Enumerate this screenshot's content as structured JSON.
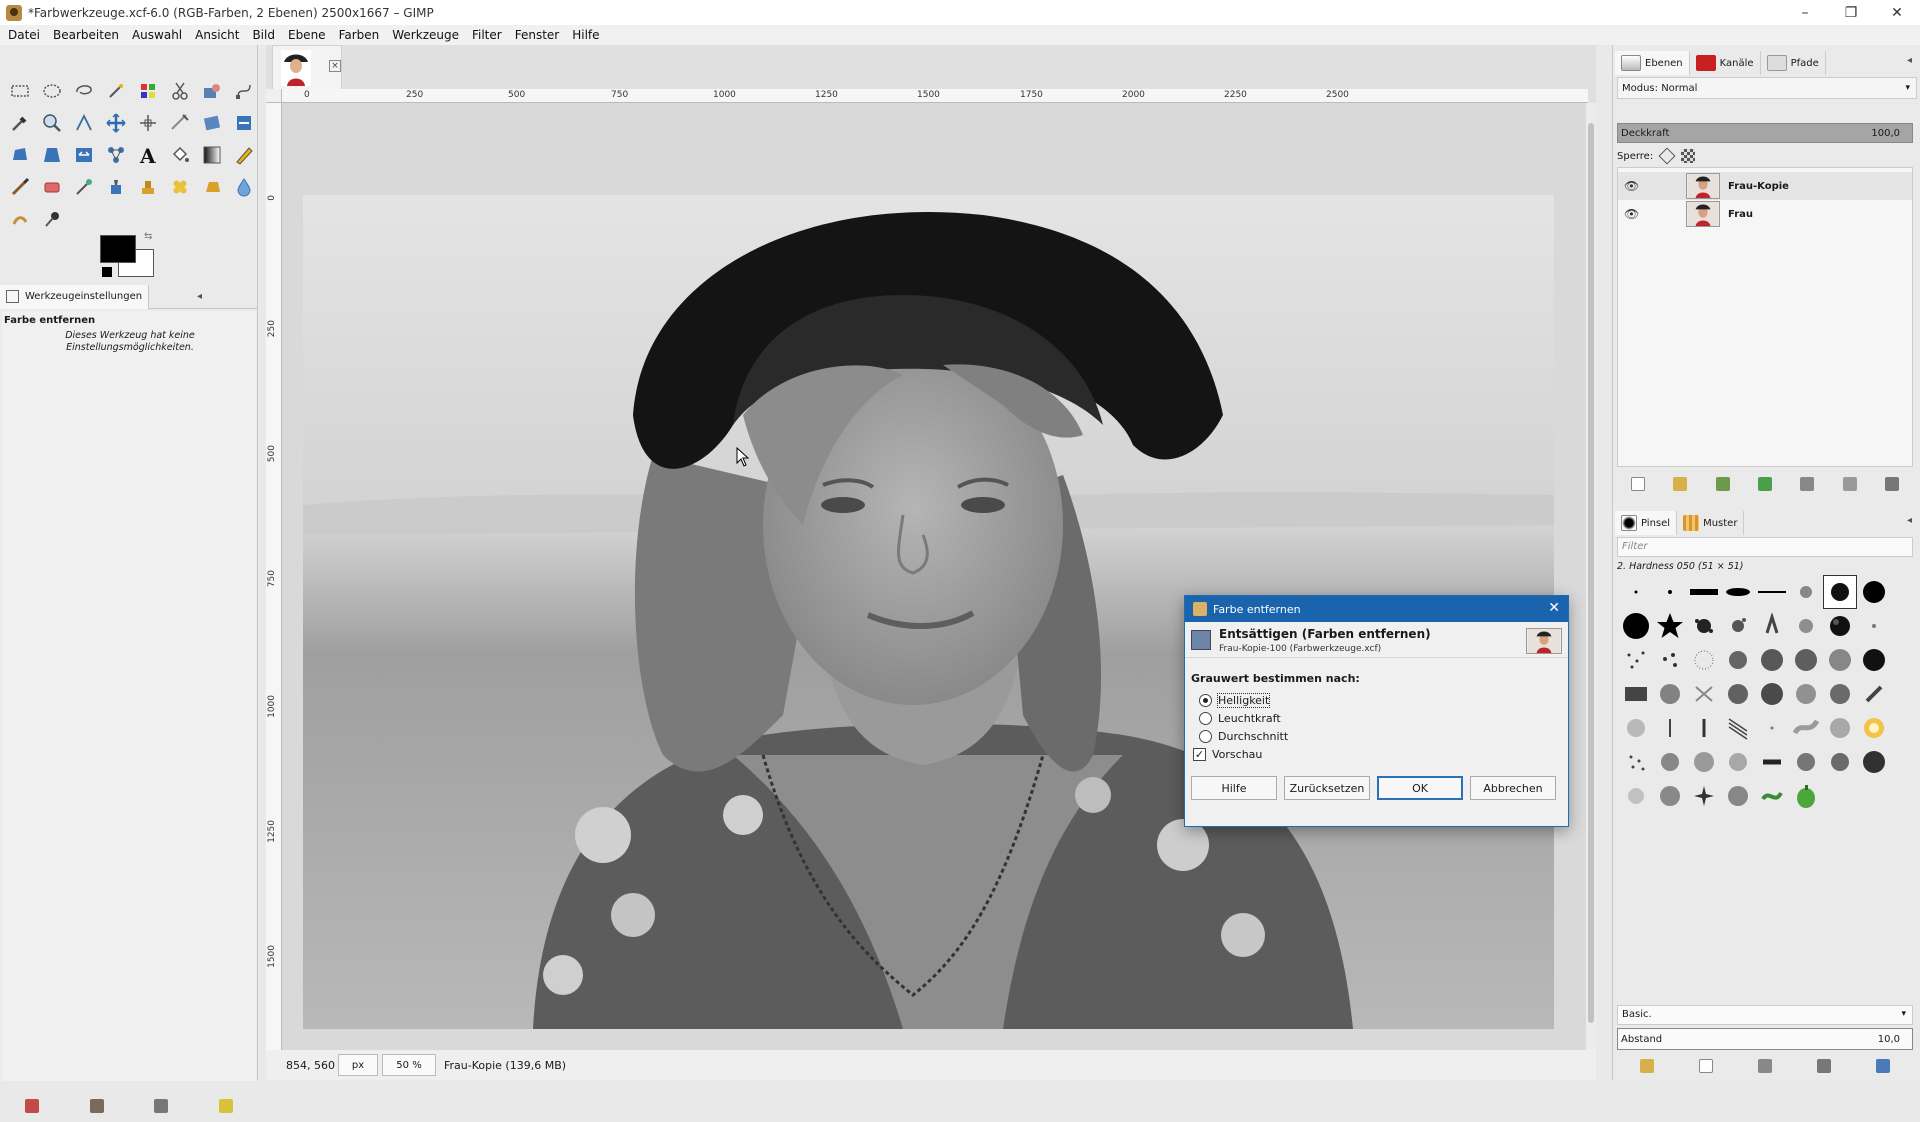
{
  "window": {
    "title": "*Farbwerkzeuge.xcf-6.0 (RGB-Farben, 2 Ebenen) 2500x1667 – GIMP",
    "controls": {
      "minimize": "–",
      "maximize": "❐",
      "close": "✕"
    }
  },
  "menubar": [
    "Datei",
    "Bearbeiten",
    "Auswahl",
    "Ansicht",
    "Bild",
    "Ebene",
    "Farben",
    "Werkzeuge",
    "Filter",
    "Fenster",
    "Hilfe"
  ],
  "toolbox": {
    "tool_options_tab": "Werkzeugeinstellungen",
    "tool_name": "Farbe entfernen",
    "tool_note": "Dieses Werkzeug hat keine Einstellungsmöglichkeiten."
  },
  "image_tab": {
    "close": "×"
  },
  "rulers": {
    "horizontal": [
      "0",
      "250",
      "500",
      "750",
      "1000",
      "1250",
      "1500",
      "1750",
      "2000",
      "2250",
      "2500"
    ],
    "vertical": [
      "0",
      "250",
      "500",
      "750",
      "1000",
      "1250",
      "1500"
    ]
  },
  "statusbar": {
    "coords": "854, 560",
    "unit": "px",
    "zoom": "50 %",
    "layer_info": "Frau-Kopie (139,6 MB)"
  },
  "dock": {
    "tabs": [
      "Ebenen",
      "Kanäle",
      "Pfade"
    ],
    "mode_label": "Modus: Normal",
    "opacity_label": "Deckkraft",
    "opacity_value": "100,0",
    "lock_label": "Sperre:",
    "layers": [
      {
        "name": "Frau-Kopie",
        "selected": true
      },
      {
        "name": "Frau",
        "selected": false
      }
    ],
    "brush_tabs": [
      "Pinsel",
      "Muster"
    ],
    "brush_filter_placeholder": "Filter",
    "brush_name": "2. Hardness 050 (51 × 51)",
    "brush_tag": "Basic.",
    "spacing_label": "Abstand",
    "spacing_value": "10,0"
  },
  "dialog": {
    "title": "Farbe entfernen",
    "heading": "Entsättigen (Farben entfernen)",
    "subheading": "Frau-Kopie-100 (Farbwerkzeuge.xcf)",
    "section": "Grauwert bestimmen nach:",
    "options": [
      {
        "label": "Helligkeit",
        "selected": true
      },
      {
        "label": "Leuchtkraft",
        "selected": false
      },
      {
        "label": "Durchschnitt",
        "selected": false
      }
    ],
    "preview_label": "Vorschau",
    "preview_checked": true,
    "buttons": {
      "help": "Hilfe",
      "reset": "Zurücksetzen",
      "ok": "OK",
      "cancel": "Abbrechen"
    }
  },
  "colors": {
    "accent": "#1a64ad",
    "foreground": "#000000",
    "background": "#ffffff"
  }
}
